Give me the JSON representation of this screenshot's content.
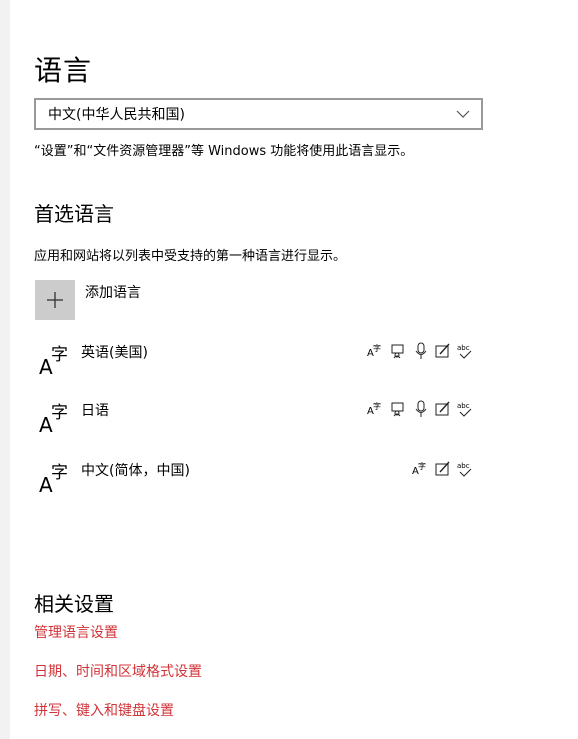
{
  "page": {
    "title": "语言"
  },
  "display_language": {
    "selected": "中文(中华人民共和国)",
    "description": "“设置”和“文件资源管理器”等 Windows 功能将使用此语言显示。"
  },
  "preferred": {
    "title": "首选语言",
    "description": "应用和网站将以列表中受支持的第一种语言进行显示。",
    "add_label": "添加语言",
    "languages": [
      {
        "name": "英语(美国)",
        "features": [
          "display-language-icon",
          "speech-recognition-icon",
          "microphone-icon",
          "handwriting-icon",
          "spell-check-icon",
          "abc-check-icon"
        ]
      },
      {
        "name": "日语",
        "features": [
          "display-language-icon",
          "speech-recognition-icon",
          "microphone-icon",
          "handwriting-icon",
          "abc-check-icon"
        ]
      },
      {
        "name": "中文(简体，中国)",
        "features": [
          "display-language-icon",
          "handwriting-icon",
          "abc-check-icon"
        ]
      }
    ]
  },
  "related": {
    "title": "相关设置",
    "links": [
      "管理语言设置",
      "日期、时间和区域格式设置",
      "拼写、键入和键盘设置"
    ]
  },
  "colors": {
    "link": "#d13438",
    "tile": "#cccccc"
  }
}
